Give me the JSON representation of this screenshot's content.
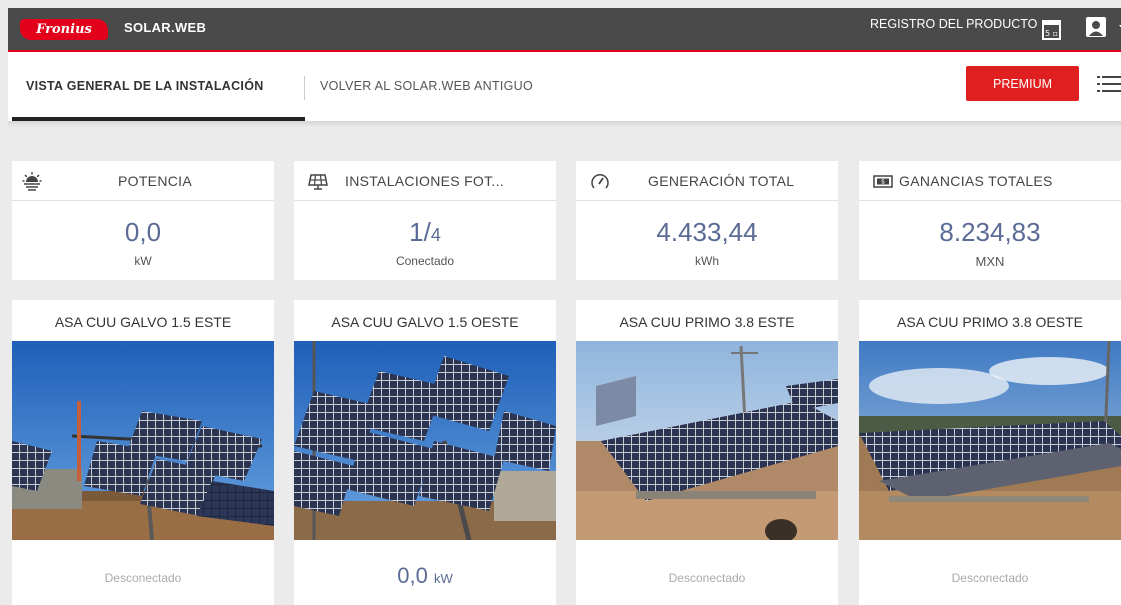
{
  "header": {
    "logo_text": "Fronius",
    "app_name": "SOLAR.WEB",
    "register_label": "REGISTRO DEL PRODUCTO",
    "register_icon": "register-icon",
    "user_icon": "user-icon",
    "brand_color": "#e3001b"
  },
  "nav": {
    "active_tab": "VISTA GENERAL DE LA INSTALACIÓN",
    "old_link": "VOLVER AL SOLAR.WEB ANTIGUO",
    "premium_label": "PREMIUM",
    "menu_icon": "list-menu-icon"
  },
  "stats": [
    {
      "icon": "sun-icon",
      "title": "POTENCIA",
      "value": "0,0",
      "value_suffix": "",
      "unit": "kW"
    },
    {
      "icon": "solar-panel-icon",
      "title": "INSTALACIONES FOT...",
      "value": "1/",
      "value_suffix": "4",
      "unit": "Conectado"
    },
    {
      "icon": "gauge-icon",
      "title": "GENERACIÓN TOTAL",
      "value": "4.433,44",
      "value_suffix": "",
      "unit": "kWh"
    },
    {
      "icon": "money-icon",
      "title": "GANANCIAS TOTALES",
      "value": "8.234,83",
      "value_suffix": "",
      "unit": "MXN"
    }
  ],
  "installations": [
    {
      "name": "ASA CUU GALVO 1.5 ESTE",
      "status": "Desconectado"
    },
    {
      "name": "ASA CUU GALVO 1.5 OESTE",
      "power": "0,0",
      "power_unit": "kW"
    },
    {
      "name": "ASA CUU PRIMO 3.8 ESTE",
      "status": "Desconectado"
    },
    {
      "name": "ASA CUU PRIMO 3.8 OESTE",
      "status": "Desconectado"
    }
  ]
}
